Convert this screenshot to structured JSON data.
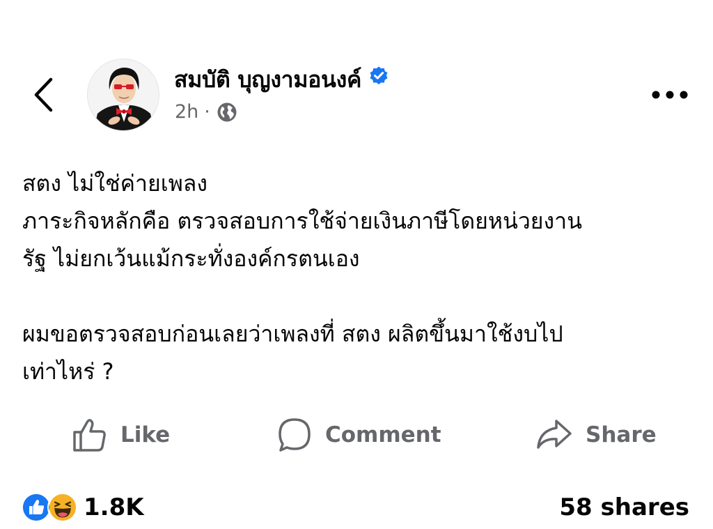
{
  "post": {
    "author": "สมบัติ บุญงามอนงค์",
    "verified": true,
    "time": "2h",
    "separator": "·",
    "audience_icon": "globe-icon",
    "body_lines": [
      "สตง ไม่ใช่ค่ายเพลง",
      "ภาระกิจหลักคือ ตรวจสอบการใช้จ่ายเงินภาษีโดยหน่วยงาน",
      "รัฐ ไม่ยกเว้นแม้กระทั่งองค์กรตนเอง"
    ],
    "body_lines_2": [
      "ผมขอตรวจสอบก่อนเลยว่าเพลงที่ สตง ผลิตขึ้นมาใช้งบไป",
      "เท่าไหร่ ?"
    ]
  },
  "actions": {
    "like": "Like",
    "comment": "Comment",
    "share": "Share"
  },
  "stats": {
    "reaction_icons": [
      "like-icon",
      "haha-icon"
    ],
    "reaction_count": "1.8K",
    "shares": "58 shares"
  },
  "colors": {
    "verified_blue": "#1877f2",
    "muted_gray": "#65676b",
    "text": "#050505"
  }
}
